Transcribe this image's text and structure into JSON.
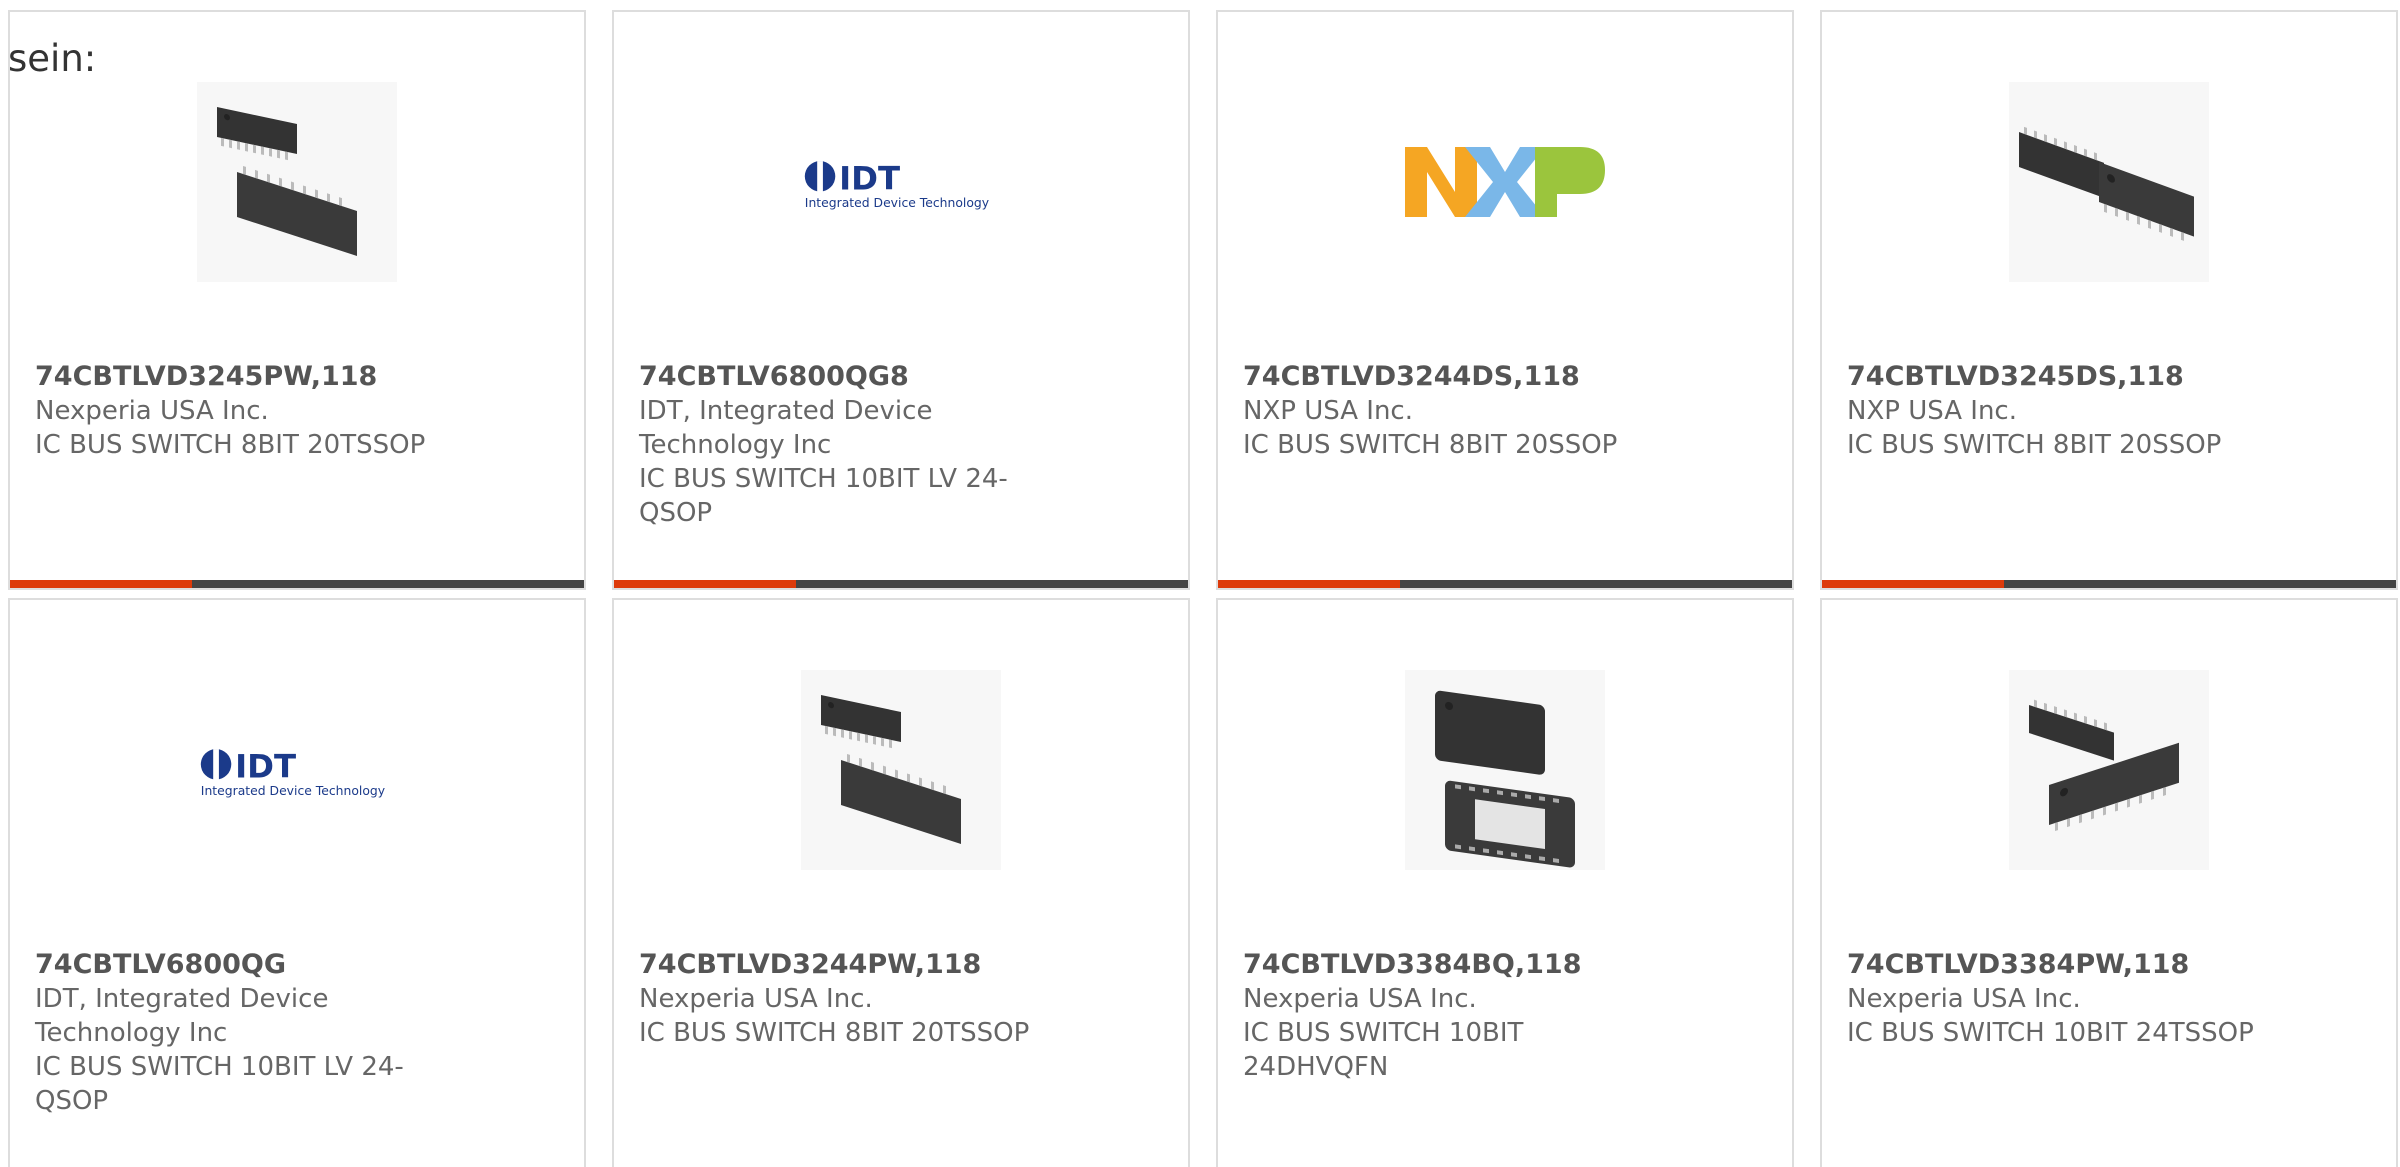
{
  "intro": "sein:",
  "colors": {
    "accent": "#dd3a0a",
    "bar": "#444444",
    "border": "#dddddd"
  },
  "cards": [
    {
      "part": "74CBTLVD3245PW,118",
      "manufacturer": "Nexperia USA Inc.",
      "description": "IC BUS SWITCH 8BIT 20TSSOP",
      "image": "chip-pair-image"
    },
    {
      "part": "74CBTLV6800QG8",
      "manufacturer": "IDT, Integrated Device Technology Inc",
      "description": "IC BUS SWITCH 10BIT LV 24-QSOP",
      "image": "idt-logo",
      "logo_text": "IDT",
      "logo_sub": "Integrated Device Technology"
    },
    {
      "part": "74CBTLVD3244DS,118",
      "manufacturer": "NXP USA Inc.",
      "description": "IC BUS SWITCH 8BIT 20SSOP",
      "image": "nxp-logo"
    },
    {
      "part": "74CBTLVD3245DS,118",
      "manufacturer": "NXP USA Inc.",
      "description": "IC BUS SWITCH 8BIT 20SSOP",
      "image": "chip-pair-image"
    },
    {
      "part": "74CBTLV6800QG",
      "manufacturer": "IDT, Integrated Device Technology Inc",
      "description": "IC BUS SWITCH 10BIT LV 24-QSOP",
      "image": "idt-logo",
      "logo_text": "IDT",
      "logo_sub": "Integrated Device Technology"
    },
    {
      "part": "74CBTLVD3244PW,118",
      "manufacturer": "Nexperia USA Inc.",
      "description": "IC BUS SWITCH 8BIT 20TSSOP",
      "image": "chip-pair-image"
    },
    {
      "part": "74CBTLVD3384BQ,118",
      "manufacturer": "Nexperia USA Inc.",
      "description": "IC BUS SWITCH 10BIT 24DHVQFN",
      "image": "qfn-chip-image"
    },
    {
      "part": "74CBTLVD3384PW,118",
      "manufacturer": "Nexperia USA Inc.",
      "description": "IC BUS SWITCH 10BIT 24TSSOP",
      "image": "chip-pair-image"
    }
  ]
}
